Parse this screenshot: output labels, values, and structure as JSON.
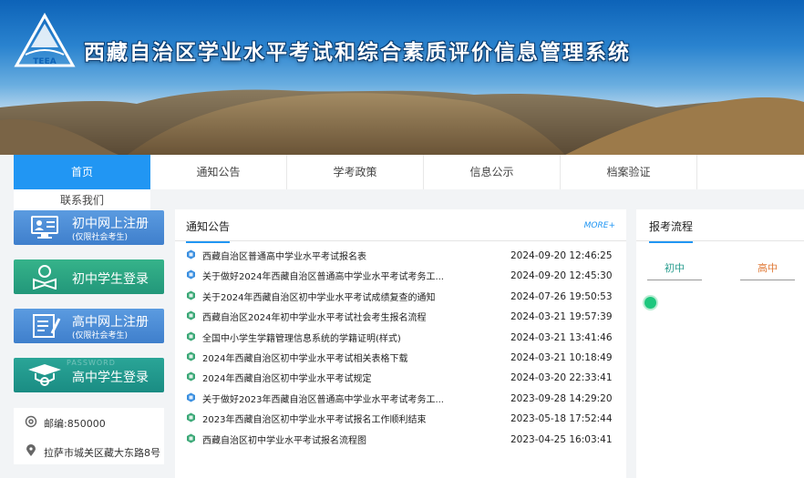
{
  "header": {
    "logo_text": "TEEA",
    "site_title": "西藏自治区学业水平考试和综合素质评价信息管理系统"
  },
  "nav": {
    "items": [
      "首页",
      "通知公告",
      "学考政策",
      "信息公示",
      "档案验证"
    ],
    "extra": "联系我们"
  },
  "sidebar": {
    "buttons": [
      {
        "line1": "初中网上注册",
        "line2": "(仅限社会考生)",
        "icon": "computer-user-icon"
      },
      {
        "line1": "初中学生登录",
        "icon": "student-reading-icon"
      },
      {
        "line1": "高中网上注册",
        "line2": "(仅限社会考生)",
        "icon": "form-pencil-icon"
      },
      {
        "line1": "高中学生登录",
        "watermark": "PASSWORD",
        "icon": "graduate-cap-icon"
      }
    ],
    "contact": [
      {
        "icon": "at-icon",
        "text": "邮编:850000"
      },
      {
        "icon": "location-pin-icon",
        "text": "拉萨市城关区藏大东路8号"
      }
    ]
  },
  "notices": {
    "title": "通知公告",
    "more": "MORE+",
    "items": [
      {
        "title": "西藏自治区普通高中学业水平考试报名表",
        "date": "2024-09-20 12:46:25",
        "badge": "blue"
      },
      {
        "title": "关于做好2024年西藏自治区普通高中学业水平考试考务工...",
        "date": "2024-09-20 12:45:30",
        "badge": "blue"
      },
      {
        "title": "关于2024年西藏自治区初中学业水平考试成绩复查的通知",
        "date": "2024-07-26 19:50:53",
        "badge": "green"
      },
      {
        "title": "西藏自治区2024年初中学业水平考试社会考生报名流程",
        "date": "2024-03-21 19:57:39",
        "badge": "green"
      },
      {
        "title": "全国中小学生学籍管理信息系统的学籍证明(样式)",
        "date": "2024-03-21 13:41:46",
        "badge": "green"
      },
      {
        "title": "2024年西藏自治区初中学业水平考试相关表格下载",
        "date": "2024-03-21 10:18:49",
        "badge": "green"
      },
      {
        "title": "2024年西藏自治区初中学业水平考试规定",
        "date": "2024-03-20 22:33:41",
        "badge": "green"
      },
      {
        "title": "关于做好2023年西藏自治区普通高中学业水平考试考务工...",
        "date": "2023-09-28 14:29:20",
        "badge": "blue"
      },
      {
        "title": "2023年西藏自治区初中学业水平考试报名工作顺利结束",
        "date": "2023-05-18 17:52:44",
        "badge": "green"
      },
      {
        "title": "西藏自治区初中学业水平考试报名流程图",
        "date": "2023-04-25 16:03:41",
        "badge": "green"
      }
    ]
  },
  "process": {
    "title": "报考流程",
    "tabs": [
      "初中",
      "高中"
    ],
    "tab_colors": [
      "#2a9d8f",
      "#e07b39"
    ]
  },
  "colors": {
    "accent": "#2196f3",
    "badge_blue": "#3a8fe0",
    "badge_green": "#3aa876"
  }
}
